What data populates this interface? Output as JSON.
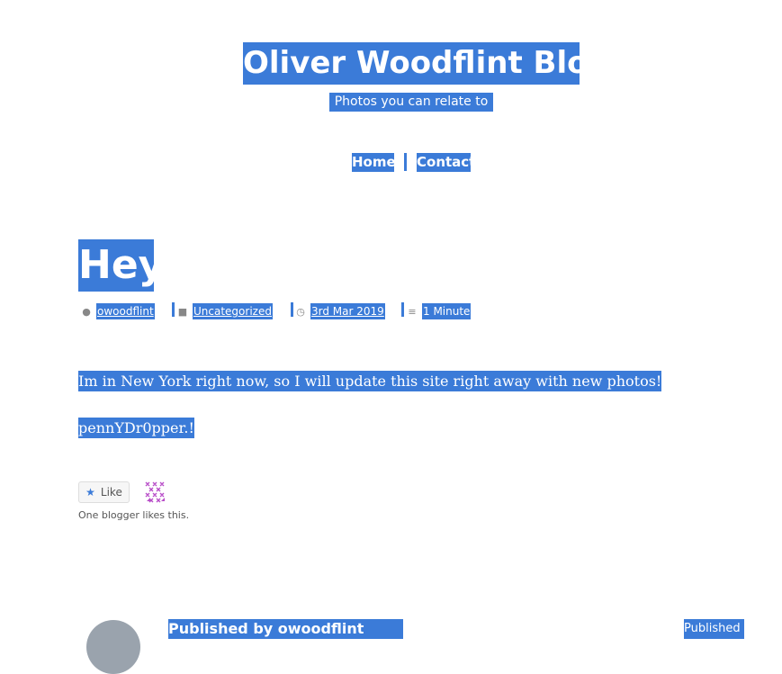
{
  "site": {
    "title": "Oliver Woodflint Blog",
    "description": "Photos you can relate to"
  },
  "nav": {
    "items": [
      {
        "label": "Home"
      },
      {
        "label": "Contact"
      }
    ]
  },
  "post": {
    "title": "Hey",
    "meta": {
      "author": "owoodflint",
      "category": "Uncategorized",
      "date": "3rd Mar 2019",
      "reading_time": "1 Minute"
    },
    "paragraphs": [
      "Im in New York right now, so I will update this site right away with new photos!",
      "pennYDr0pper.!"
    ]
  },
  "likes": {
    "button_label": "Like",
    "count_text": "One blogger likes this."
  },
  "author_box": {
    "heading": "Published by owoodflint",
    "published_label": "Published"
  },
  "colors": {
    "highlight": "#3b7bd8",
    "background": "#ffffff"
  }
}
